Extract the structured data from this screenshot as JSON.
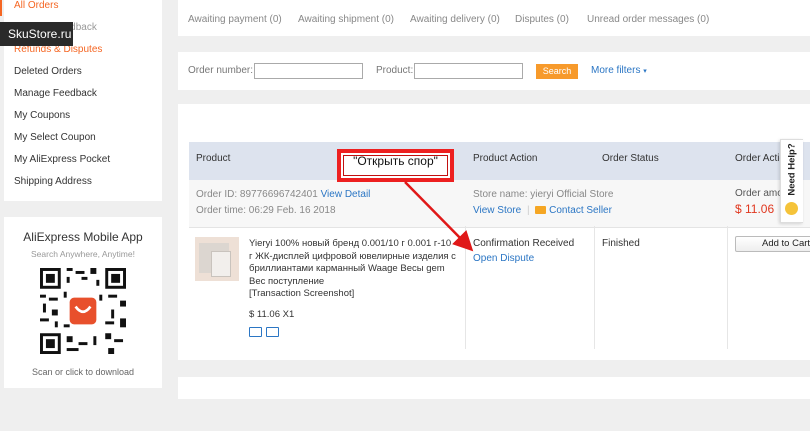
{
  "sidebar": {
    "items": [
      {
        "label": "All Orders",
        "active": true
      },
      {
        "label": "Manage Feedback",
        "active": false
      },
      {
        "label": "Refunds & Disputes",
        "active": true
      },
      {
        "label": "Deleted Orders",
        "active": false
      },
      {
        "label": "Manage Feedback",
        "active": false
      },
      {
        "label": "My Coupons",
        "active": false
      },
      {
        "label": "My Select Coupon",
        "active": false
      },
      {
        "label": "My AliExpress Pocket",
        "active": false
      },
      {
        "label": "Shipping Address",
        "active": false
      }
    ]
  },
  "watermark": "SkuStore.ru",
  "app": {
    "title": "AliExpress Mobile App",
    "subtitle": "Search Anywhere, Anytime!",
    "caption": "Scan or click to download"
  },
  "tabs": [
    "Awaiting payment (0)",
    "Awaiting shipment (0)",
    "Awaiting delivery (0)",
    "Disputes (0)",
    "Unread order messages (0)"
  ],
  "search": {
    "order_number_label": "Order number:",
    "product_label": "Product:",
    "button": "Search",
    "more_filters": "More filters"
  },
  "table": {
    "headers": [
      "Product",
      "Product Action",
      "Order Status",
      "Order Action"
    ]
  },
  "order": {
    "id_label": "Order ID:",
    "id": "89776696742401",
    "view_detail": "View Detail",
    "time_label": "Order time:",
    "time": "06:29 Feb. 16 2018",
    "store_label": "Store name:",
    "store": "yieryi Official Store",
    "view_store": "View Store",
    "contact_seller": "Contact Seller",
    "amount_label": "Order amo",
    "amount": "$ 11.06",
    "product_title": "Yieryi 100% новый бренд 0.001/10 г 0.001 г-10 г ЖК-дисплей цифровой ювелирные изделия с бриллиантами карманный Waage Весы gem Вес поступление",
    "snapshot": "[Transaction Screenshot]",
    "price_qty": "$ 11.06 X1",
    "action_status": "Confirmation Received",
    "open_dispute": "Open Dispute",
    "order_status": "Finished",
    "add_to_cart": "Add to Cart"
  },
  "annotation": "\"Открыть спор\"",
  "need_help": "Need Help?",
  "colors": {
    "accent": "#f56623",
    "link": "#2b76c4",
    "annotation_red": "#e01818",
    "header_bg": "#dde3ee"
  }
}
